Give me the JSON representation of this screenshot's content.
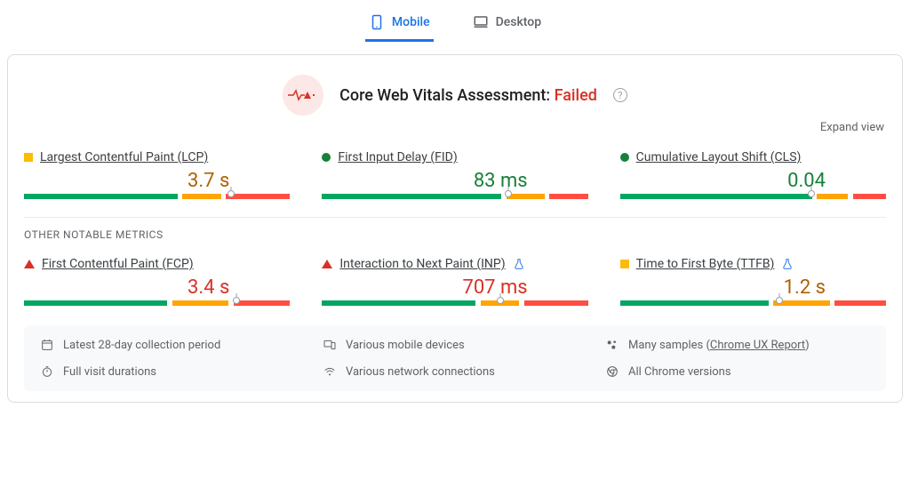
{
  "tabs": {
    "mobile": "Mobile",
    "desktop": "Desktop"
  },
  "assessment": {
    "prefix": "Core Web Vitals Assessment: ",
    "status": "Failed"
  },
  "expand": "Expand view",
  "section_other": "OTHER NOTABLE METRICS",
  "metrics": {
    "lcp": {
      "name": "Largest Contentful Paint (LCP)",
      "value": "3.7 s",
      "shape": "square",
      "tone": "amber",
      "seg_g": 60,
      "seg_a": 15,
      "seg_r": 25,
      "caret": 78
    },
    "fid": {
      "name": "First Input Delay (FID)",
      "value": "83 ms",
      "shape": "circle",
      "tone": "green",
      "seg_g": 70,
      "seg_a": 15,
      "seg_r": 15,
      "caret": 70
    },
    "cls": {
      "name": "Cumulative Layout Shift (CLS)",
      "value": "0.04",
      "shape": "circle",
      "tone": "green",
      "seg_g": 75,
      "seg_a": 12,
      "seg_r": 13,
      "caret": 72
    },
    "fcp": {
      "name": "First Contentful Paint (FCP)",
      "value": "3.4 s",
      "shape": "triangle",
      "tone": "red",
      "seg_g": 56,
      "seg_a": 22,
      "seg_r": 22,
      "caret": 80
    },
    "inp": {
      "name": "Interaction to Next Paint (INP)",
      "value": "707 ms",
      "shape": "triangle",
      "tone": "red",
      "seg_g": 60,
      "seg_a": 15,
      "seg_r": 25,
      "caret": 67
    },
    "ttfb": {
      "name": "Time to First Byte (TTFB)",
      "value": "1.2 s",
      "shape": "square",
      "tone": "amber",
      "seg_g": 58,
      "seg_a": 22,
      "seg_r": 20,
      "caret": 60
    }
  },
  "footer": {
    "period": "Latest 28-day collection period",
    "devices": "Various mobile devices",
    "samples_prefix": "Many samples (",
    "samples_link": "Chrome UX Report",
    "samples_suffix": ")",
    "durations": "Full visit durations",
    "network": "Various network connections",
    "versions": "All Chrome versions"
  }
}
